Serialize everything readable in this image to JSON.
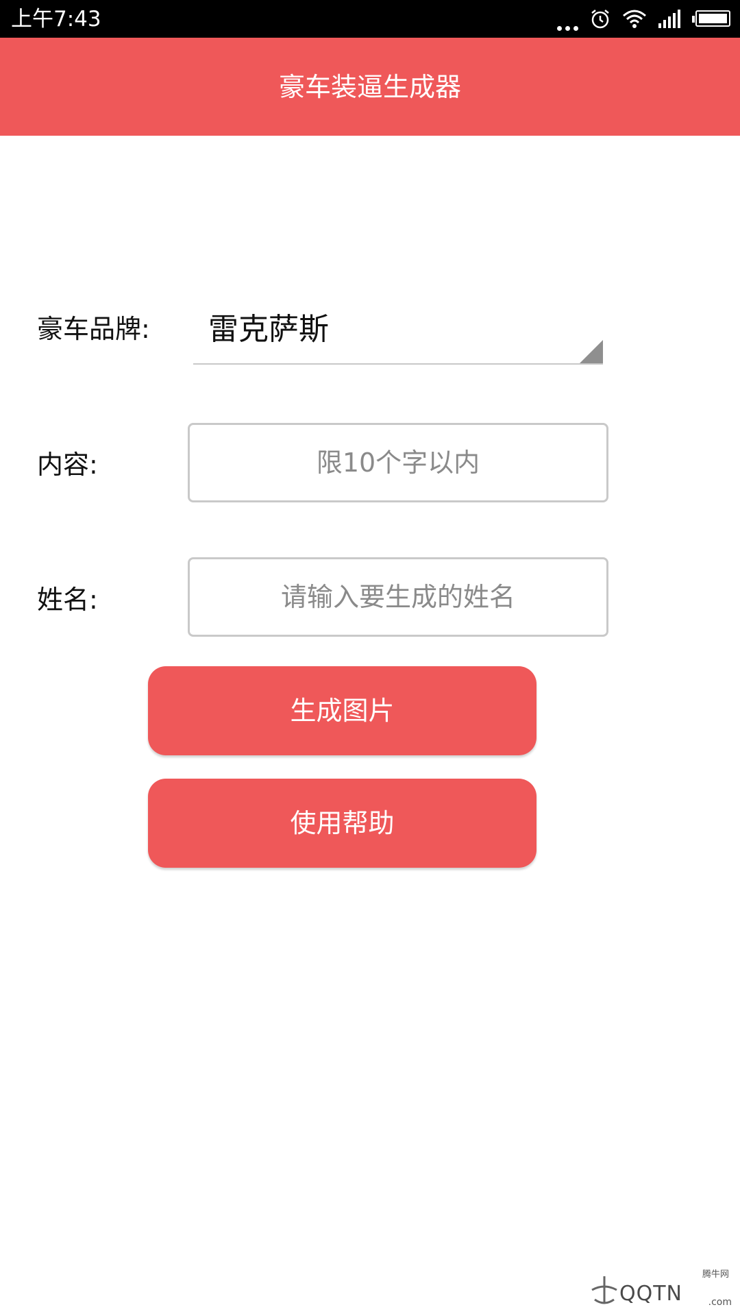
{
  "status_bar": {
    "time": "上午7:43",
    "icons": [
      "more-dots-icon",
      "alarm-icon",
      "wifi-icon",
      "signal-icon",
      "battery-icon"
    ]
  },
  "app_bar": {
    "title": "豪车装逼生成器",
    "color": "#ef5859"
  },
  "form": {
    "brand_label": "豪车品牌:",
    "brand_value": "雷克萨斯",
    "content_label": "内容:",
    "content_placeholder": "限10个字以内",
    "name_label": "姓名:",
    "name_placeholder": "请输入要生成的姓名"
  },
  "buttons": {
    "generate_label": "生成图片",
    "help_label": "使用帮助"
  },
  "watermark": {
    "text": "QQTN",
    "small_text": "腾牛网",
    "suffix": ".com"
  }
}
